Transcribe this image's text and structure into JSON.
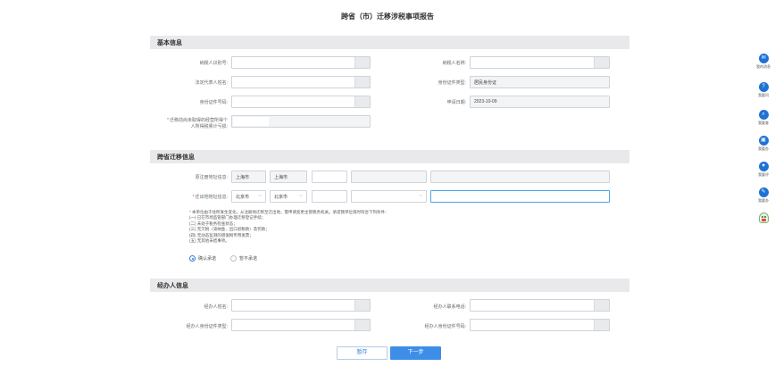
{
  "page": {
    "title": "跨省（市）迁移涉税事项报告"
  },
  "basic": {
    "title": "基本信息",
    "taxpayer_id_label": "纳税人识别号:",
    "taxpayer_id_value": "",
    "taxpayer_name_label": "纳税人名称:",
    "taxpayer_name_value": "",
    "legal_rep_label": "法定代表人姓名:",
    "legal_rep_value": "",
    "id_type_label": "身份证件类型:",
    "id_type_value": "居民身份证",
    "id_number_label": "身份证件号码:",
    "id_number_value": "",
    "apply_date_label": "申请日期:",
    "apply_date_value": "2023-10-09",
    "income_label_line1": "迁移前尚未取得的经营所得个",
    "income_label_line2": "人所得税累计亏损:",
    "income_value": ""
  },
  "migration": {
    "title": "跨省迁移信息",
    "origin_label": "原注册地址信息:",
    "origin_province": "上海市",
    "origin_city": "上海市",
    "dest_label": "迁出地地址信息:",
    "dest_province": "北京市",
    "dest_city": "北京市",
    "notice_lines": [
      "本单位由于住所发生变化，从注册地迁移至迁出地，需申请变更主管税务机关。承诺我单位现时符合下列条件：",
      "(一) 已在市场监管部门办理迁移登记手续；",
      "(二) 未处于税务检查状态；",
      "(三) 无欠税（滞纳金、出口退税款）及罚款；",
      "(四) 无动态监测的增值税专用发票；",
      "(五) 无其他未结事项。"
    ],
    "radio_confirm": "确认承诺",
    "radio_deny": "暂不承诺"
  },
  "agent": {
    "title": "经办人信息",
    "name_label": "经办人姓名:",
    "name_value": "",
    "phone_label": "经办人联系电话:",
    "phone_value": "",
    "id_type_label": "经办人身份证件类型:",
    "id_type_value": "",
    "id_number_label": "经办人身份证件号码:",
    "id_number_value": ""
  },
  "actions": {
    "save_label": "暂存",
    "next_label": "下一步"
  },
  "sidebar": {
    "items": [
      {
        "label": "我的消息",
        "icon": "message-icon"
      },
      {
        "label": "我要问",
        "icon": "question-icon"
      },
      {
        "label": "我要查",
        "icon": "search-icon"
      },
      {
        "label": "我要办",
        "icon": "calendar-icon"
      },
      {
        "label": "我要评",
        "icon": "heart-icon"
      },
      {
        "label": "我要办",
        "icon": "pen-icon"
      }
    ]
  },
  "colors": {
    "accent": "#3c8ee8",
    "section_bg": "#e9e9ec",
    "required": "#e54d42"
  }
}
